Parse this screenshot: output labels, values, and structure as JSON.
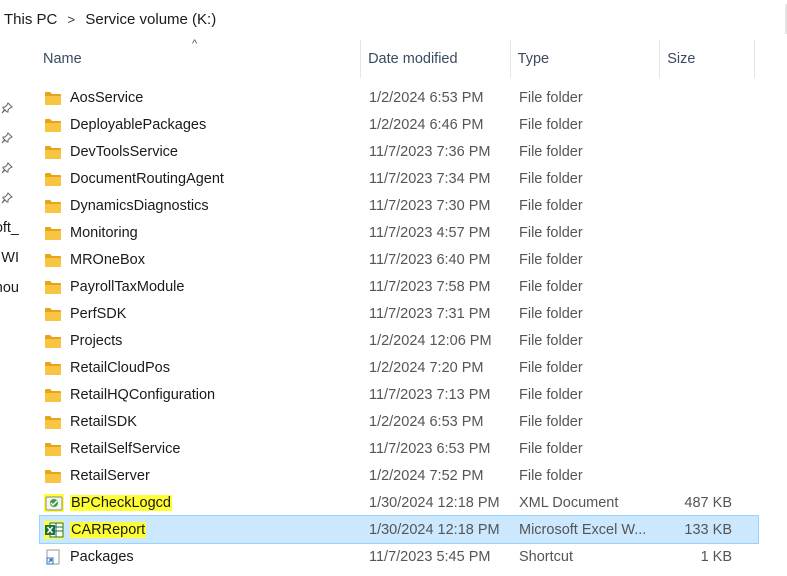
{
  "breadcrumb": {
    "items": [
      "This PC",
      "Service volume (K:)"
    ],
    "separator": ">"
  },
  "nav_pane": {
    "partial_labels": [
      "oft_",
      "WI",
      "hou"
    ]
  },
  "columns": {
    "name": "Name",
    "date": "Date modified",
    "type": "Type",
    "size": "Size"
  },
  "files": [
    {
      "name": "AosService",
      "date": "1/2/2024 6:53 PM",
      "type": "File folder",
      "size": "",
      "icon": "folder-icon"
    },
    {
      "name": "DeployablePackages",
      "date": "1/2/2024 6:46 PM",
      "type": "File folder",
      "size": "",
      "icon": "folder-icon"
    },
    {
      "name": "DevToolsService",
      "date": "11/7/2023 7:36 PM",
      "type": "File folder",
      "size": "",
      "icon": "folder-icon"
    },
    {
      "name": "DocumentRoutingAgent",
      "date": "11/7/2023 7:34 PM",
      "type": "File folder",
      "size": "",
      "icon": "folder-icon"
    },
    {
      "name": "DynamicsDiagnostics",
      "date": "11/7/2023 7:30 PM",
      "type": "File folder",
      "size": "",
      "icon": "folder-icon"
    },
    {
      "name": "Monitoring",
      "date": "11/7/2023 4:57 PM",
      "type": "File folder",
      "size": "",
      "icon": "folder-icon"
    },
    {
      "name": "MROneBox",
      "date": "11/7/2023 6:40 PM",
      "type": "File folder",
      "size": "",
      "icon": "folder-icon"
    },
    {
      "name": "PayrollTaxModule",
      "date": "11/7/2023 7:58 PM",
      "type": "File folder",
      "size": "",
      "icon": "folder-icon"
    },
    {
      "name": "PerfSDK",
      "date": "11/7/2023 7:31 PM",
      "type": "File folder",
      "size": "",
      "icon": "folder-icon"
    },
    {
      "name": "Projects",
      "date": "1/2/2024 12:06 PM",
      "type": "File folder",
      "size": "",
      "icon": "folder-icon"
    },
    {
      "name": "RetailCloudPos",
      "date": "1/2/2024 7:20 PM",
      "type": "File folder",
      "size": "",
      "icon": "folder-icon"
    },
    {
      "name": "RetailHQConfiguration",
      "date": "11/7/2023 7:13 PM",
      "type": "File folder",
      "size": "",
      "icon": "folder-icon"
    },
    {
      "name": "RetailSDK",
      "date": "1/2/2024 6:53 PM",
      "type": "File folder",
      "size": "",
      "icon": "folder-icon"
    },
    {
      "name": "RetailSelfService",
      "date": "11/7/2023 6:53 PM",
      "type": "File folder",
      "size": "",
      "icon": "folder-icon"
    },
    {
      "name": "RetailServer",
      "date": "1/2/2024 7:52 PM",
      "type": "File folder",
      "size": "",
      "icon": "folder-icon"
    },
    {
      "name": "BPCheckLogcd",
      "date": "1/30/2024 12:18 PM",
      "type": "XML Document",
      "size": "487 KB",
      "icon": "xml-file-icon",
      "highlighted": true
    },
    {
      "name": "CARReport",
      "date": "1/30/2024 12:18 PM",
      "type": "Microsoft Excel W...",
      "size": "133 KB",
      "icon": "excel-file-icon",
      "highlighted": true,
      "selected": true
    },
    {
      "name": "Packages",
      "date": "11/7/2023 5:45 PM",
      "type": "Shortcut",
      "size": "1 KB",
      "icon": "shortcut-icon"
    }
  ],
  "colors": {
    "folder": "#f8c542",
    "selection": "#cce8ff",
    "highlight": "#ffff33",
    "excel": "#1d7044"
  }
}
